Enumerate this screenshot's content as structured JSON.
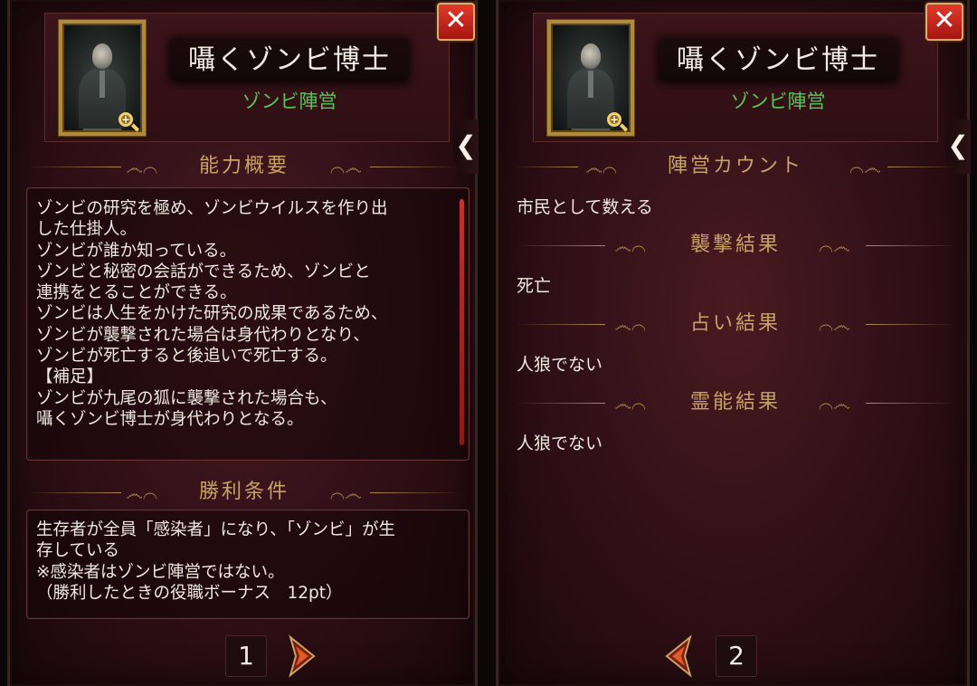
{
  "left_panel": {
    "role_name": "囁くゾンビ博士",
    "faction": "ゾンビ陣営",
    "close_label": "✕",
    "side_tab_label": "❮",
    "ability_title": "能力概要",
    "ability_text": "ゾンビの研究を極め、ゾンビウイルスを作り出\nした仕掛人。\nゾンビが誰か知っている。\nゾンビと秘密の会話ができるため、ゾンビと\n連携をとることができる。\nゾンビは人生をかけた研究の成果であるため、\nゾンビが襲撃された場合は身代わりとなり、\nゾンビが死亡すると後追いで死亡する。\n【補足】\nゾンビが九尾の狐に襲撃された場合も、\n囁くゾンビ博士が身代わりとなる。",
    "victory_title": "勝利条件",
    "victory_text": "生存者が全員「感染者」になり、「ゾンビ」が生\n存している\n※感染者はゾンビ陣営ではない。\n（勝利したときの役職ボーナス　12pt）",
    "page_number": "1"
  },
  "right_panel": {
    "role_name": "囁くゾンビ博士",
    "faction": "ゾンビ陣営",
    "close_label": "✕",
    "side_tab_label": "❮",
    "sections": [
      {
        "title": "陣営カウント",
        "value": "市民として数える"
      },
      {
        "title": "襲撃結果",
        "value": "死亡"
      },
      {
        "title": "占い結果",
        "value": "人狼でない"
      },
      {
        "title": "霊能結果",
        "value": "人狼でない"
      }
    ],
    "page_number": "2"
  },
  "colors": {
    "faction": "#5ac45a",
    "section_title": "#c8a266",
    "close_button": "#d32a1e",
    "scrollbar": "#c83030"
  }
}
